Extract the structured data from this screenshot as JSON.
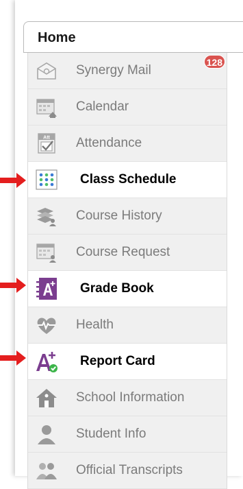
{
  "home": {
    "label": "Home"
  },
  "menu": [
    {
      "label": "Synergy Mail",
      "icon": "mail-icon",
      "badge": "128",
      "highlighted": false
    },
    {
      "label": "Calendar",
      "icon": "calendar-icon",
      "highlighted": false
    },
    {
      "label": "Attendance",
      "icon": "attendance-icon",
      "highlighted": false
    },
    {
      "label": "Class Schedule",
      "icon": "class-schedule-icon",
      "highlighted": true
    },
    {
      "label": "Course History",
      "icon": "course-history-icon",
      "highlighted": false
    },
    {
      "label": "Course Request",
      "icon": "course-request-icon",
      "highlighted": false
    },
    {
      "label": "Grade Book",
      "icon": "grade-book-icon",
      "highlighted": true
    },
    {
      "label": "Health",
      "icon": "health-icon",
      "highlighted": false
    },
    {
      "label": "Report Card",
      "icon": "report-card-icon",
      "highlighted": true
    },
    {
      "label": "School Information",
      "icon": "school-information-icon",
      "highlighted": false
    },
    {
      "label": "Student Info",
      "icon": "student-info-icon",
      "highlighted": false
    },
    {
      "label": "Official Transcripts",
      "icon": "official-transcripts-icon",
      "highlighted": false
    }
  ],
  "icon_texts": {
    "attendance": "Att"
  },
  "colors": {
    "arrow": "#e41e1e",
    "badge": "#d9534f",
    "grade_book_purple": "#7b3d8f",
    "check_green": "#3cb54a",
    "muted_icon": "#a7a7a7"
  }
}
